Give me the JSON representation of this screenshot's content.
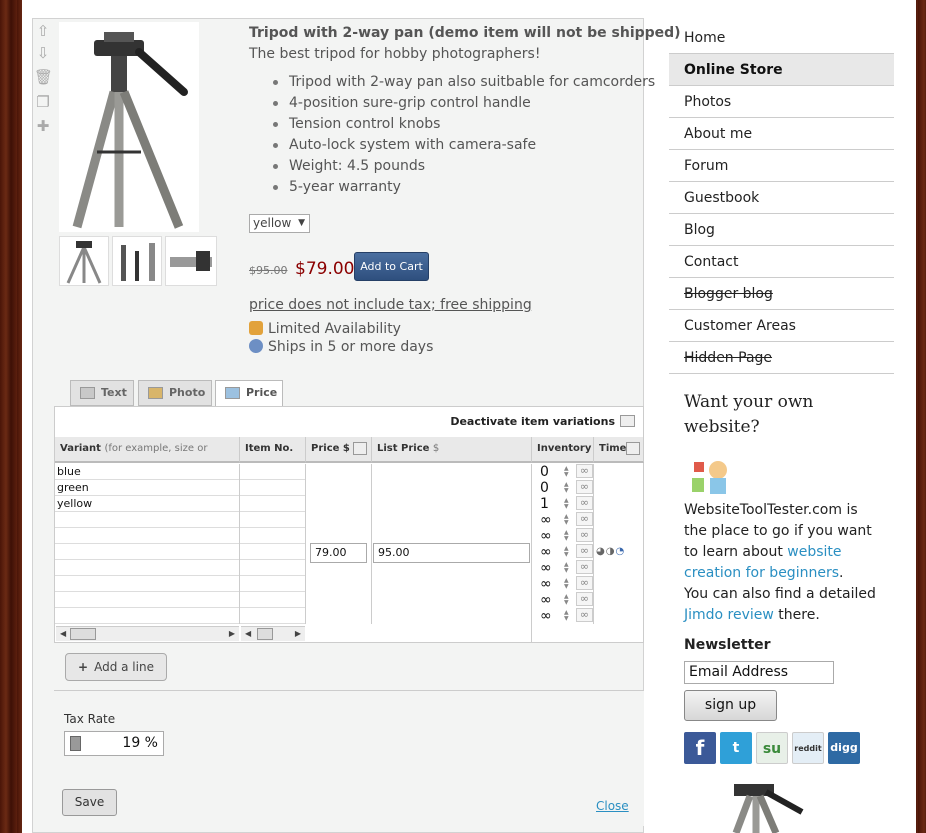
{
  "product": {
    "title": "Tripod with 2-way pan (demo item will not be shipped)",
    "subtitle": "The best tripod for hobby photographers!",
    "features": [
      "Tripod with 2-way pan also suitbable for camcorders",
      "4-position sure-grip control handle",
      "Tension control knobs",
      "Auto-lock system with camera-safe",
      "Weight: 4.5 pounds",
      "5-year warranty"
    ],
    "selected_variant": "yellow",
    "old_price": "$95.00",
    "price": "$79.00",
    "add_to_cart": "Add to Cart",
    "tax_note": "price does not include tax; free shipping",
    "availability": "Limited Availability",
    "shipping": "Ships in 5 or more days"
  },
  "tabs": [
    "Text",
    "Photo",
    "Price"
  ],
  "variants": {
    "deactivate": "Deactivate item variations",
    "headers": {
      "variant": "Variant",
      "variant_hint": "(for example, size or color)",
      "item_no": "Item No.",
      "price": "Price $",
      "list_price": "List Price",
      "list_unit": "$",
      "inventory": "Inventory",
      "time": "Time"
    },
    "names": [
      "blue",
      "green",
      "yellow",
      "",
      "",
      "",
      "",
      "",
      "",
      ""
    ],
    "inventory": [
      "0",
      "0",
      "1",
      "∞",
      "∞",
      "∞",
      "∞",
      "∞",
      "∞",
      "∞"
    ],
    "price_value": "79.00",
    "list_price_value": "95.00"
  },
  "add_line": "Add a line",
  "tax": {
    "label": "Tax Rate",
    "value": "19 %"
  },
  "save": "Save",
  "close": "Close",
  "nav": [
    "Home",
    "Online Store",
    "Photos",
    "About me",
    "Forum",
    "Guestbook",
    "Blog",
    "Contact",
    "Blogger blog",
    "Customer Areas",
    "Hidden Page"
  ],
  "sidebar": {
    "heading": "Want your own website?",
    "text1": "WebsiteToolTester.com is the place to go if you want to learn about ",
    "link1": "website creation for beginners",
    "text2": ".",
    "text3": "You can also find a detailed ",
    "link2": "Jimdo review",
    "text4": " there.",
    "newsletter": "Newsletter",
    "email_placeholder": "Email Address",
    "signup": "sign up",
    "social": [
      "f",
      "t",
      "su",
      "reddit",
      "digg"
    ]
  },
  "colors": {
    "price_red": "#8b0000",
    "cart_blue": "#2e4f7e",
    "link_blue": "#2a8fc2"
  }
}
